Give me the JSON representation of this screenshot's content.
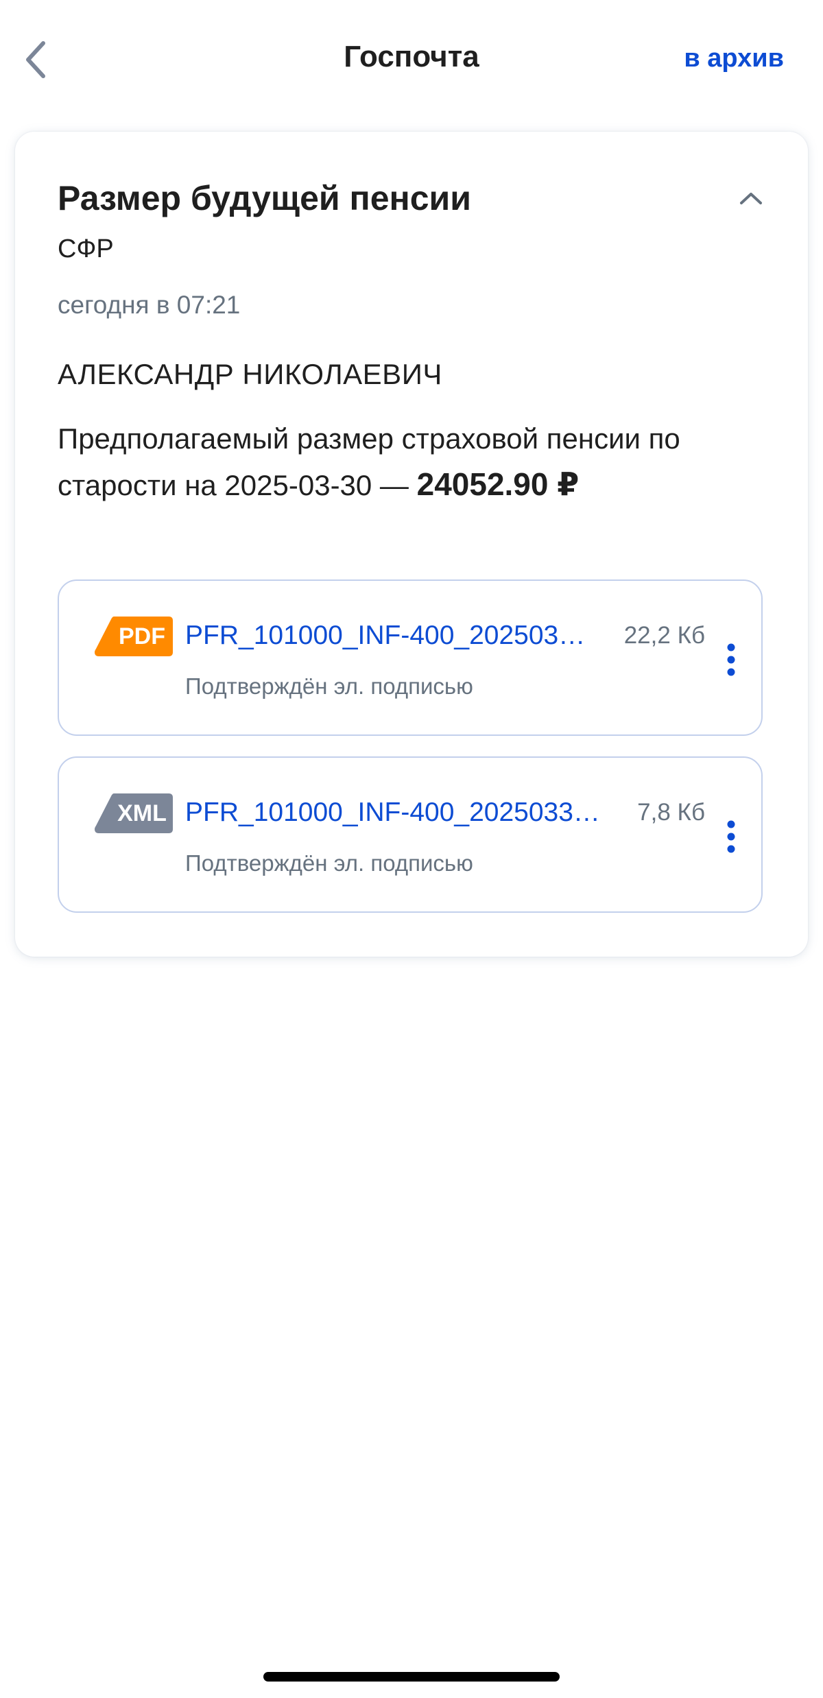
{
  "header": {
    "title": "Госпочта",
    "archive_label": "в архив",
    "back_icon": "chevron-left-icon"
  },
  "message": {
    "title": "Размер будущей пенсии",
    "sender": "СФР",
    "timestamp": "сегодня в 07:21",
    "recipient": "АЛЕКСАНДР НИКОЛАЕВИЧ",
    "body_text": "Предполагаемый размер страховой пенсии по старости на 2025-03-30 — ",
    "amount": "24052.90 ₽",
    "collapse_icon": "chevron-up-icon"
  },
  "attachments": [
    {
      "type": "PDF",
      "type_color": "#ff8a00",
      "name": "PFR_101000_INF-400_2025033...",
      "size": "22,2 Кб",
      "status": "Подтверждён эл. подписью",
      "menu_icon": "more-vertical-icon"
    },
    {
      "type": "XML",
      "type_color": "#7c8698",
      "name": "PFR_101000_INF-400_20250330...",
      "size": "7,8 Кб",
      "status": "Подтверждён эл. подписью",
      "menu_icon": "more-vertical-icon"
    }
  ],
  "colors": {
    "accent": "#0d4cd3",
    "muted_text": "#66727f",
    "attachment_border": "#c3d0ec"
  }
}
